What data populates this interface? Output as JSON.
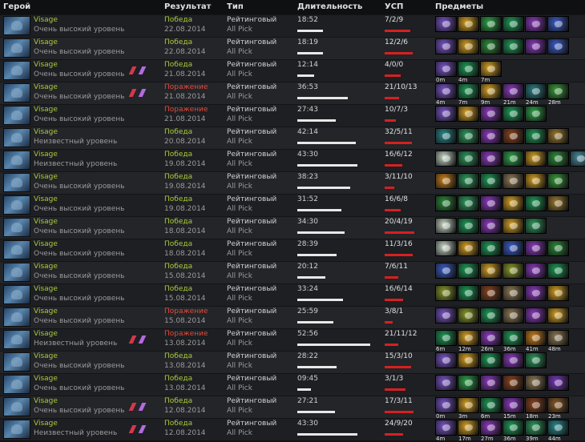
{
  "headers": {
    "hero": "Герой",
    "result": "Результат",
    "type": "Тип",
    "duration": "Длительность",
    "kda": "УСП",
    "items": "Предметы"
  },
  "colors": {
    "win": "#a8c938",
    "loss": "#e24a3a",
    "kda_bar": "#d62020",
    "duration_bar": "#e8e8e8"
  },
  "matches": [
    {
      "hero": "Visage",
      "skill": "Очень высокий уровень",
      "party": false,
      "result": "Победа",
      "win": true,
      "date": "22.08.2014",
      "type": "Рейтинговый",
      "mode": "All Pick",
      "duration": "18:52",
      "kda": "7/2/9",
      "items": [
        {
          "icon": "arcane-boots-icon",
          "color": "#7a55c8",
          "time": ""
        },
        {
          "icon": "hand-of-midas-icon",
          "color": "#d4a024",
          "time": ""
        },
        {
          "icon": "blink-dagger-icon",
          "color": "#2fa34a",
          "time": ""
        },
        {
          "icon": "boots-icon",
          "color": "#1f9a58",
          "time": ""
        },
        {
          "icon": "staff-icon",
          "color": "#8c3bbf",
          "time": ""
        },
        {
          "icon": "force-staff-icon",
          "color": "#3b5ec9",
          "time": ""
        }
      ]
    },
    {
      "hero": "Visage",
      "skill": "Очень высокий уровень",
      "party": false,
      "result": "Победа",
      "win": true,
      "date": "22.08.2014",
      "type": "Рейтинговый",
      "mode": "All Pick",
      "duration": "18:19",
      "kda": "12/2/6",
      "items": [
        {
          "icon": "arcane-boots-icon",
          "color": "#7a55c8",
          "time": ""
        },
        {
          "icon": "hand-of-midas-icon",
          "color": "#d4a024",
          "time": ""
        },
        {
          "icon": "urn-icon",
          "color": "#2f8d3c",
          "time": ""
        },
        {
          "icon": "boots-icon",
          "color": "#1f9a58",
          "time": ""
        },
        {
          "icon": "staff-icon",
          "color": "#8c3bbf",
          "time": ""
        },
        {
          "icon": "force-staff-icon",
          "color": "#3b5ec9",
          "time": ""
        }
      ]
    },
    {
      "hero": "Visage",
      "skill": "Очень высокий уровень",
      "party": true,
      "result": "Победа",
      "win": true,
      "date": "21.08.2014",
      "type": "Рейтинговый",
      "mode": "All Pick",
      "duration": "12:14",
      "kda": "4/0/0",
      "items": [
        {
          "icon": "arcane-boots-icon",
          "color": "#7a55c8",
          "time": "0m"
        },
        {
          "icon": "boots-icon",
          "color": "#1f9a58",
          "time": "4m"
        },
        {
          "icon": "hand-of-midas-icon",
          "color": "#d4a024",
          "time": "7m"
        }
      ]
    },
    {
      "hero": "Visage",
      "skill": "Очень высокий уровень",
      "party": true,
      "result": "Поражение",
      "win": false,
      "date": "21.08.2014",
      "type": "Рейтинговый",
      "mode": "All Pick",
      "duration": "36:53",
      "kda": "21/10/13",
      "items": [
        {
          "icon": "arcane-boots-icon",
          "color": "#7a55c8",
          "time": "4m"
        },
        {
          "icon": "boots-icon",
          "color": "#1f9a58",
          "time": "7m"
        },
        {
          "icon": "hand-of-midas-icon",
          "color": "#d4a024",
          "time": "9m"
        },
        {
          "icon": "staff-icon",
          "color": "#8c3bbf",
          "time": "21m"
        },
        {
          "icon": "aghanim-icon",
          "color": "#2c7d86",
          "time": "24m"
        },
        {
          "icon": "dragon-lance-icon",
          "color": "#3b9a3c",
          "time": "28m"
        }
      ]
    },
    {
      "hero": "Visage",
      "skill": "Очень высокий уровень",
      "party": false,
      "result": "Поражение",
      "win": false,
      "date": "21.08.2014",
      "type": "Рейтинговый",
      "mode": "All Pick",
      "duration": "27:43",
      "kda": "10/7/3",
      "items": [
        {
          "icon": "arcane-boots-icon",
          "color": "#7a55c8",
          "time": ""
        },
        {
          "icon": "hand-of-midas-icon",
          "color": "#d4a024",
          "time": ""
        },
        {
          "icon": "staff-icon",
          "color": "#8c3bbf",
          "time": ""
        },
        {
          "icon": "boots-icon",
          "color": "#1f9a58",
          "time": ""
        },
        {
          "icon": "blink-dagger-icon",
          "color": "#2fa34a",
          "time": ""
        }
      ]
    },
    {
      "hero": "Visage",
      "skill": "Неизвестный уровень",
      "party": false,
      "result": "Победа",
      "win": true,
      "date": "20.08.2014",
      "type": "Рейтинговый",
      "mode": "All Pick",
      "duration": "42:14",
      "kda": "32/5/11",
      "items": [
        {
          "icon": "aether-lens-icon",
          "color": "#2a8a8d",
          "time": ""
        },
        {
          "icon": "scythe-icon",
          "color": "#2f9a5e",
          "time": ""
        },
        {
          "icon": "staff-icon",
          "color": "#8c3bbf",
          "time": ""
        },
        {
          "icon": "mask-icon",
          "color": "#8a4420",
          "time": ""
        },
        {
          "icon": "boots-icon",
          "color": "#1f9a58",
          "time": ""
        },
        {
          "icon": "wand-icon",
          "color": "#9a7a30",
          "time": ""
        }
      ]
    },
    {
      "hero": "Visage",
      "skill": "Неизвестный уровень",
      "party": false,
      "result": "Победа",
      "win": true,
      "date": "19.08.2014",
      "type": "Рейтинговый",
      "mode": "All Pick",
      "duration": "43:30",
      "kda": "16/6/12",
      "items": [
        {
          "icon": "eul-icon",
          "color": "#c8d8c8",
          "time": ""
        },
        {
          "icon": "scythe-icon",
          "color": "#2f9a5e",
          "time": ""
        },
        {
          "icon": "staff-icon",
          "color": "#8c3bbf",
          "time": ""
        },
        {
          "icon": "blink-dagger-icon",
          "color": "#2fa34a",
          "time": ""
        },
        {
          "icon": "hand-of-midas-icon",
          "color": "#d4a024",
          "time": ""
        },
        {
          "icon": "urn-icon",
          "color": "#2f8d3c",
          "time": ""
        },
        {
          "icon": "skull-icon",
          "color": "#4a8a9a",
          "time": ""
        }
      ]
    },
    {
      "hero": "Visage",
      "skill": "Очень высокий уровень",
      "party": false,
      "result": "Победа",
      "win": true,
      "date": "19.08.2014",
      "type": "Рейтинговый",
      "mode": "All Pick",
      "duration": "38:23",
      "kda": "3/11/10",
      "items": [
        {
          "icon": "orb-icon",
          "color": "#c8801e",
          "time": ""
        },
        {
          "icon": "scythe-icon",
          "color": "#2f9a5e",
          "time": ""
        },
        {
          "icon": "boots-icon",
          "color": "#1f9a58",
          "time": ""
        },
        {
          "icon": "scroll-icon",
          "color": "#8e7a55",
          "time": ""
        },
        {
          "icon": "hand-of-midas-icon",
          "color": "#d4a024",
          "time": ""
        },
        {
          "icon": "dragon-lance-icon",
          "color": "#3b9a3c",
          "time": ""
        }
      ]
    },
    {
      "hero": "Visage",
      "skill": "Очень высокий уровень",
      "party": false,
      "result": "Победа",
      "win": true,
      "date": "19.08.2014",
      "type": "Рейтинговый",
      "mode": "All Pick",
      "duration": "31:52",
      "kda": "16/6/8",
      "items": [
        {
          "icon": "orb-icon",
          "color": "#2c8a3a",
          "time": ""
        },
        {
          "icon": "scythe-icon",
          "color": "#2f9a5e",
          "time": ""
        },
        {
          "icon": "staff-icon",
          "color": "#8c3bbf",
          "time": ""
        },
        {
          "icon": "hand-of-midas-icon",
          "color": "#d4a024",
          "time": ""
        },
        {
          "icon": "boots-icon",
          "color": "#1f9a58",
          "time": ""
        },
        {
          "icon": "wand-icon",
          "color": "#9a7a30",
          "time": ""
        }
      ]
    },
    {
      "hero": "Visage",
      "skill": "Очень высокий уровень",
      "party": false,
      "result": "Победа",
      "win": true,
      "date": "18.08.2014",
      "type": "Рейтинговый",
      "mode": "All Pick",
      "duration": "34:30",
      "kda": "20/4/19",
      "items": [
        {
          "icon": "eul-icon",
          "color": "#c8d8c8",
          "time": ""
        },
        {
          "icon": "boots-icon",
          "color": "#1f9a58",
          "time": ""
        },
        {
          "icon": "staff-icon",
          "color": "#8c3bbf",
          "time": ""
        },
        {
          "icon": "hand-of-midas-icon",
          "color": "#d4a024",
          "time": ""
        },
        {
          "icon": "scythe-icon",
          "color": "#2f9a5e",
          "time": ""
        }
      ]
    },
    {
      "hero": "Visage",
      "skill": "Очень высокий уровень",
      "party": false,
      "result": "Победа",
      "win": true,
      "date": "18.08.2014",
      "type": "Рейтинговый",
      "mode": "All Pick",
      "duration": "28:39",
      "kda": "11/3/16",
      "items": [
        {
          "icon": "eul-icon",
          "color": "#c8d8c8",
          "time": ""
        },
        {
          "icon": "hand-of-midas-icon",
          "color": "#d4a024",
          "time": ""
        },
        {
          "icon": "boots-icon",
          "color": "#1f9a58",
          "time": ""
        },
        {
          "icon": "force-staff-icon",
          "color": "#3b5ec9",
          "time": ""
        },
        {
          "icon": "staff-icon",
          "color": "#8c3bbf",
          "time": ""
        },
        {
          "icon": "orb-icon",
          "color": "#2c8a3a",
          "time": ""
        }
      ]
    },
    {
      "hero": "Visage",
      "skill": "Очень высокий уровень",
      "party": false,
      "result": "Победа",
      "win": true,
      "date": "15.08.2014",
      "type": "Рейтинговый",
      "mode": "All Pick",
      "duration": "20:12",
      "kda": "7/6/11",
      "items": [
        {
          "icon": "force-staff-icon",
          "color": "#3b5ec9",
          "time": ""
        },
        {
          "icon": "boots-icon",
          "color": "#1f9a58",
          "time": ""
        },
        {
          "icon": "hand-of-midas-icon",
          "color": "#d4a024",
          "time": ""
        },
        {
          "icon": "dragon-lance-icon",
          "color": "#8a9a2a",
          "time": ""
        },
        {
          "icon": "staff-icon",
          "color": "#8c3bbf",
          "time": ""
        },
        {
          "icon": "boots-icon",
          "color": "#1f9a58",
          "time": ""
        }
      ]
    },
    {
      "hero": "Visage",
      "skill": "Очень высокий уровень",
      "party": false,
      "result": "Победа",
      "win": true,
      "date": "15.08.2014",
      "type": "Рейтинговый",
      "mode": "All Pick",
      "duration": "33:24",
      "kda": "16/6/14",
      "items": [
        {
          "icon": "dragon-lance-icon",
          "color": "#8a9a2a",
          "time": ""
        },
        {
          "icon": "boots-icon",
          "color": "#1f9a58",
          "time": ""
        },
        {
          "icon": "mask-icon",
          "color": "#8a4420",
          "time": ""
        },
        {
          "icon": "scroll-icon",
          "color": "#8e7a55",
          "time": ""
        },
        {
          "icon": "staff-icon",
          "color": "#8c3bbf",
          "time": ""
        },
        {
          "icon": "hand-of-midas-icon",
          "color": "#d4a024",
          "time": ""
        }
      ]
    },
    {
      "hero": "Visage",
      "skill": "Очень высокий уровень",
      "party": false,
      "result": "Поражение",
      "win": false,
      "date": "15.08.2014",
      "type": "Рейтинговый",
      "mode": "All Pick",
      "duration": "25:59",
      "kda": "3/8/1",
      "items": [
        {
          "icon": "arcane-boots-icon",
          "color": "#7a55c8",
          "time": ""
        },
        {
          "icon": "dragon-lance-icon",
          "color": "#8a9a2a",
          "time": ""
        },
        {
          "icon": "boots-icon",
          "color": "#1f9a58",
          "time": ""
        },
        {
          "icon": "scroll-icon",
          "color": "#8e7a55",
          "time": ""
        },
        {
          "icon": "staff-icon",
          "color": "#8c3bbf",
          "time": ""
        },
        {
          "icon": "hand-of-midas-icon",
          "color": "#d4a024",
          "time": ""
        }
      ]
    },
    {
      "hero": "Visage",
      "skill": "Неизвестный уровень",
      "party": true,
      "result": "Поражение",
      "win": false,
      "date": "13.08.2014",
      "type": "Рейтинговый",
      "mode": "All Pick",
      "duration": "52:56",
      "kda": "21/11/12",
      "items": [
        {
          "icon": "boots-icon",
          "color": "#1f9a58",
          "time": "6m"
        },
        {
          "icon": "hand-of-midas-icon",
          "color": "#d4a024",
          "time": "12m"
        },
        {
          "icon": "staff-icon",
          "color": "#8c3bbf",
          "time": "26m"
        },
        {
          "icon": "boots-icon",
          "color": "#1f9a58",
          "time": "36m"
        },
        {
          "icon": "orb-icon",
          "color": "#c8801e",
          "time": "41m"
        },
        {
          "icon": "scroll-icon",
          "color": "#8e7a55",
          "time": "48m"
        }
      ]
    },
    {
      "hero": "Visage",
      "skill": "Очень высокий уровень",
      "party": false,
      "result": "Победа",
      "win": true,
      "date": "13.08.2014",
      "type": "Рейтинговый",
      "mode": "All Pick",
      "duration": "28:22",
      "kda": "15/3/10",
      "items": [
        {
          "icon": "arcane-boots-icon",
          "color": "#7a55c8",
          "time": ""
        },
        {
          "icon": "hand-of-midas-icon",
          "color": "#d4a024",
          "time": ""
        },
        {
          "icon": "boots-icon",
          "color": "#1f9a58",
          "time": ""
        },
        {
          "icon": "staff-icon",
          "color": "#8c3bbf",
          "time": ""
        },
        {
          "icon": "scythe-icon",
          "color": "#2f9a5e",
          "time": ""
        }
      ]
    },
    {
      "hero": "Visage",
      "skill": "Очень высокий уровень",
      "party": false,
      "result": "Победа",
      "win": true,
      "date": "13.08.2014",
      "type": "Рейтинговый",
      "mode": "All Pick",
      "duration": "09:45",
      "kda": "3/1/3",
      "items": [
        {
          "icon": "arcane-boots-icon",
          "color": "#7a55c8",
          "time": ""
        },
        {
          "icon": "blink-dagger-icon",
          "color": "#2fa34a",
          "time": ""
        },
        {
          "icon": "staff-icon",
          "color": "#8c3bbf",
          "time": ""
        },
        {
          "icon": "mask-icon",
          "color": "#8a4420",
          "time": ""
        },
        {
          "icon": "scroll-icon",
          "color": "#8e7a55",
          "time": ""
        },
        {
          "icon": "orb-icon",
          "color": "#7a3bbf",
          "time": ""
        }
      ]
    },
    {
      "hero": "Visage",
      "skill": "Очень высокий уровень",
      "party": true,
      "result": "Победа",
      "win": true,
      "date": "12.08.2014",
      "type": "Рейтинговый",
      "mode": "All Pick",
      "duration": "27:21",
      "kda": "17/3/11",
      "items": [
        {
          "icon": "arcane-boots-icon",
          "color": "#7a55c8",
          "time": "0m"
        },
        {
          "icon": "hand-of-midas-icon",
          "color": "#d4a024",
          "time": "3m"
        },
        {
          "icon": "boots-icon",
          "color": "#1f9a58",
          "time": "6m"
        },
        {
          "icon": "staff-icon",
          "color": "#8c3bbf",
          "time": "15m"
        },
        {
          "icon": "mask-icon",
          "color": "#8a4420",
          "time": "18m"
        },
        {
          "icon": "orb-icon",
          "color": "#8a5a2a",
          "time": "23m"
        }
      ]
    },
    {
      "hero": "Visage",
      "skill": "Неизвестный уровень",
      "party": true,
      "result": "Победа",
      "win": true,
      "date": "12.08.2014",
      "type": "Рейтинговый",
      "mode": "All Pick",
      "duration": "43:30",
      "kda": "24/9/20",
      "items": [
        {
          "icon": "arcane-boots-icon",
          "color": "#7a55c8",
          "time": "4m"
        },
        {
          "icon": "hand-of-midas-icon",
          "color": "#d4a024",
          "time": "17m"
        },
        {
          "icon": "staff-icon",
          "color": "#8c3bbf",
          "time": "27m"
        },
        {
          "icon": "boots-icon",
          "color": "#1f9a58",
          "time": "36m"
        },
        {
          "icon": "scythe-icon",
          "color": "#2f9a5e",
          "time": "39m"
        },
        {
          "icon": "aether-lens-icon",
          "color": "#2a8a8d",
          "time": "44m"
        }
      ]
    }
  ]
}
